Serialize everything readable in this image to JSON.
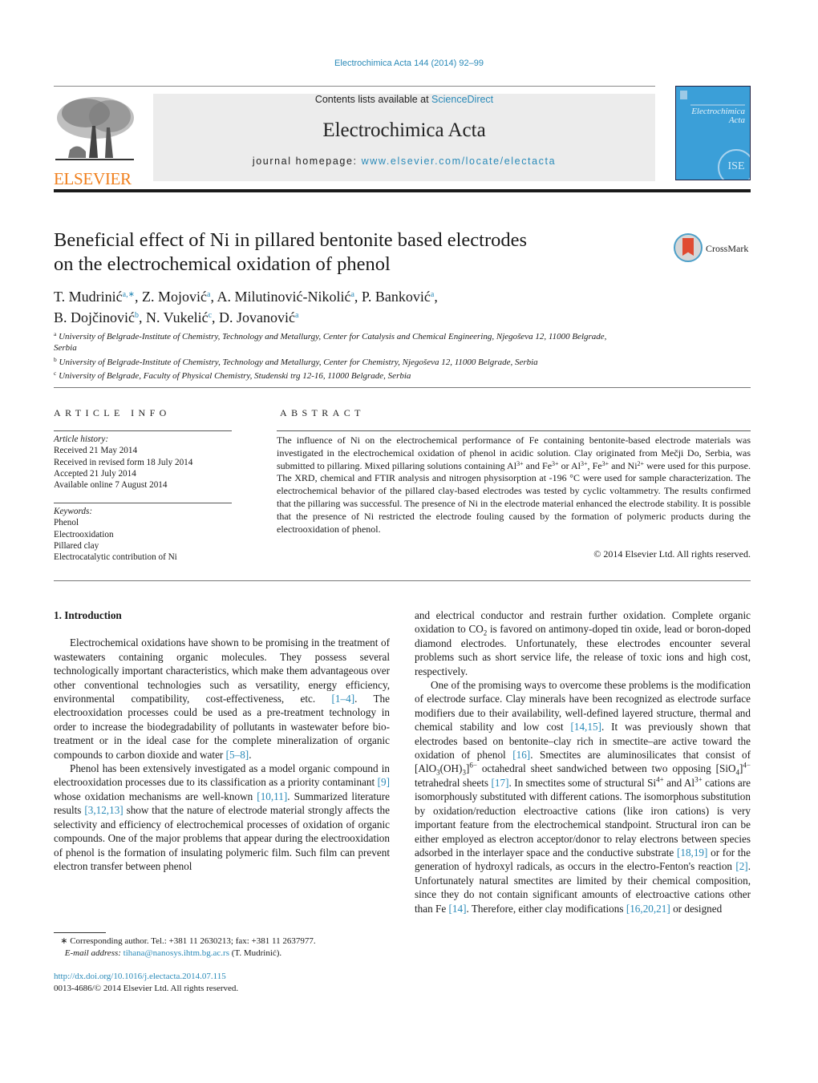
{
  "running_head": "Electrochimica Acta 144 (2014) 92–99",
  "masthead": {
    "publisher": "ELSEVIER",
    "contents_prefix": "Contents lists available at ",
    "contents_link": "ScienceDirect",
    "journal_title": "Electrochimica Acta",
    "homepage_prefix": "journal homepage: ",
    "homepage_link": "www.elsevier.com/locate/electacta",
    "cover_title_line1": "Electrochimica",
    "cover_title_line2": "Acta",
    "cover_emblem": "ISE"
  },
  "crossmark_label": "CrossMark",
  "article": {
    "title_line1": "Beneficial effect of Ni in pillared bentonite based electrodes",
    "title_line2": "on the electrochemical oxidation of phenol",
    "authors": [
      {
        "name": "T. Mudrinić",
        "aff": "a,∗",
        "sep": ", "
      },
      {
        "name": "Z. Mojović",
        "aff": "a",
        "sep": ", "
      },
      {
        "name": "A. Milutinović-Nikolić",
        "aff": "a",
        "sep": ", "
      },
      {
        "name": "P. Banković",
        "aff": "a",
        "sep": ","
      },
      {
        "name": "B. Dojčinović",
        "aff": "b",
        "sep": ", "
      },
      {
        "name": "N. Vukelić",
        "aff": "c",
        "sep": ", "
      },
      {
        "name": "D. Jovanović",
        "aff": "a",
        "sep": ""
      }
    ],
    "affiliations": [
      {
        "mark": "a",
        "text": "University of Belgrade-Institute of Chemistry, Technology and Metallurgy, Center for Catalysis and Chemical Engineering, Njegoševa 12, 11000 Belgrade, Serbia"
      },
      {
        "mark": "b",
        "text": "University of Belgrade-Institute of Chemistry, Technology and Metallurgy, Center for Chemistry, Njegoševa 12, 11000 Belgrade, Serbia"
      },
      {
        "mark": "c",
        "text": "University of Belgrade, Faculty of Physical Chemistry, Studenski trg 12-16, 11000 Belgrade, Serbia"
      }
    ]
  },
  "article_info": {
    "heading": "ARTICLE INFO",
    "history_label": "Article history:",
    "history": [
      "Received 21 May 2014",
      "Received in revised form 18 July 2014",
      "Accepted 21 July 2014",
      "Available online 7 August 2014"
    ],
    "keywords_label": "Keywords:",
    "keywords": [
      "Phenol",
      "Electrooxidation",
      "Pillared clay",
      "Electrocatalytic contribution of Ni"
    ]
  },
  "abstract": {
    "heading": "ABSTRACT",
    "t1": "The influence of Ni on the electrochemical performance of Fe containing bentonite-based electrode materials was investigated in the electrochemical oxidation of phenol in acidic solution. Clay originated from Mečji Do, Serbia, was submitted to pillaring. Mixed pillaring solutions containing Al",
    "s1": "3+",
    "t2": " and Fe",
    "s2": "3+",
    "t3": " or Al",
    "s3": "3+",
    "t4": ", Fe",
    "s4": "3+",
    "t5": " and Ni",
    "s5": "2+",
    "t6": " were used for this purpose. The XRD, chemical and FTIR analysis and nitrogen physisorption at -196 °C were used for sample characterization. The electrochemical behavior of the pillared clay-based electrodes was tested by cyclic voltammetry. The results confirmed that the pillaring was successful. The presence of Ni in the electrode material enhanced the electrode stability. It is possible that the presence of Ni restricted the electrode fouling caused by the formation of polymeric products during the electrooxidation of phenol.",
    "copyright": "© 2014 Elsevier Ltd. All rights reserved."
  },
  "introduction": {
    "heading": "1.  Introduction",
    "p1": {
      "a": "Electrochemical oxidations have shown to be promising in the treatment of wastewaters containing organic molecules. They possess several technologically important characteristics, which make them advantageous over other conventional technologies such as versatility, energy efficiency, environmental compatibility, cost-effectiveness, etc. ",
      "c1": "[1–4]",
      "b": ". The electrooxidation processes could be used as a pre-treatment technology in order to increase the biodegradability of pollutants in wastewater before bio-treatment or in the ideal case for the complete mineralization of organic compounds to carbon dioxide and water ",
      "c2": "[5–8]",
      "c": "."
    },
    "p2": {
      "a": "Phenol has been extensively investigated as a model organic compound in electrooxidation processes due to its classification as a priority contaminant ",
      "c1": "[9]",
      "b": " whose oxidation mechanisms are well-known ",
      "c2": "[10,11]",
      "c": ". Summarized literature results ",
      "c3": "[3,12,13]",
      "d": " show that the nature of electrode material strongly affects the selectivity and efficiency of electrochemical processes of oxidation of organic compounds. One of the major problems that appear during the electrooxidation of phenol is the formation of insulating polymeric film. Such film can prevent electron transfer between phenol"
    },
    "p3": {
      "a": "and electrical conductor and restrain further oxidation. Complete organic oxidation to CO",
      "sub1": "2",
      "b": " is favored on antimony-doped tin oxide, lead or boron-doped diamond electrodes. Unfortunately, these electrodes encounter several problems such as short service life, the release of toxic ions and high cost, respectively."
    },
    "p4": {
      "a": "One of the promising ways to overcome these problems is the modification of electrode surface. Clay minerals have been recognized as electrode surface modifiers due to their availability, well-defined layered structure, thermal and chemical stability and low cost ",
      "c1": "[14,15]",
      "b": ". It was previously shown that electrodes based on bentonite–clay rich in smectite–are active toward the oxidation of phenol ",
      "c2": "[16]",
      "c": ". Smectites are aluminosilicates that consist of [AlO",
      "sub1": "3",
      "d": "(OH)",
      "sub2": "3",
      "e": "]",
      "sup1": "6−",
      "f": " octahedral sheet sandwiched between two opposing [SiO",
      "sub3": "4",
      "g": "]",
      "sup2": "4−",
      "h": " tetrahedral sheets ",
      "c3": "[17]",
      "i": ". In smectites some of structural Si",
      "sup3": "4+",
      "j": " and Al",
      "sup4": "3+",
      "k": " cations are isomorphously substituted with different cations. The isomorphous substitution by oxidation/reduction electroactive cations (like iron cations) is very important feature from the electrochemical standpoint. Structural iron can be either employed as electron acceptor/donor to relay electrons between species adsorbed in the interlayer space and the conductive substrate ",
      "c4": "[18,19]",
      "l": " or for the generation of hydroxyl radicals, as occurs in the electro-Fenton's reaction ",
      "c5": "[2]",
      "m": ". Unfortunately natural smectites are limited by their chemical composition, since they do not contain significant amounts of electroactive cations other than Fe ",
      "c6": "[14]",
      "n": ". Therefore, either clay modifications ",
      "c7": "[16,20,21]",
      "o": " or designed"
    }
  },
  "footnote": {
    "star": "∗",
    "line1": " Corresponding author. Tel.: +381 11 2630213; fax: +381 11 2637977.",
    "email_label": "E-mail address: ",
    "email": "tihana@nanosys.ihtm.bg.ac.rs",
    "email_suffix": " (T. Mudrinić)."
  },
  "doi": {
    "link": "http://dx.doi.org/10.1016/j.electacta.2014.07.115",
    "issn_line": "0013-4686/© 2014 Elsevier Ltd. All rights reserved."
  }
}
